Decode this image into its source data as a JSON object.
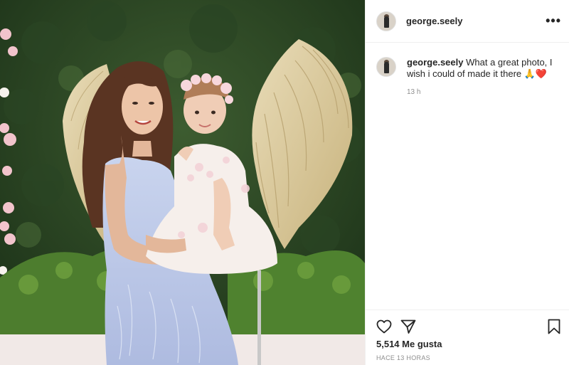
{
  "post": {
    "username": "george.seely",
    "more_icon": "more-options-icon",
    "caption_user": "george.seely",
    "caption_text": " What a great photo, I wish i could of made it there 🙏❤️",
    "comment_time": "13 h",
    "likes": "5,514 Me gusta",
    "posted_ago": "HACE 13 HORAS"
  },
  "icons": {
    "like": "heart-icon",
    "share": "paper-plane-icon",
    "save": "bookmark-icon"
  }
}
